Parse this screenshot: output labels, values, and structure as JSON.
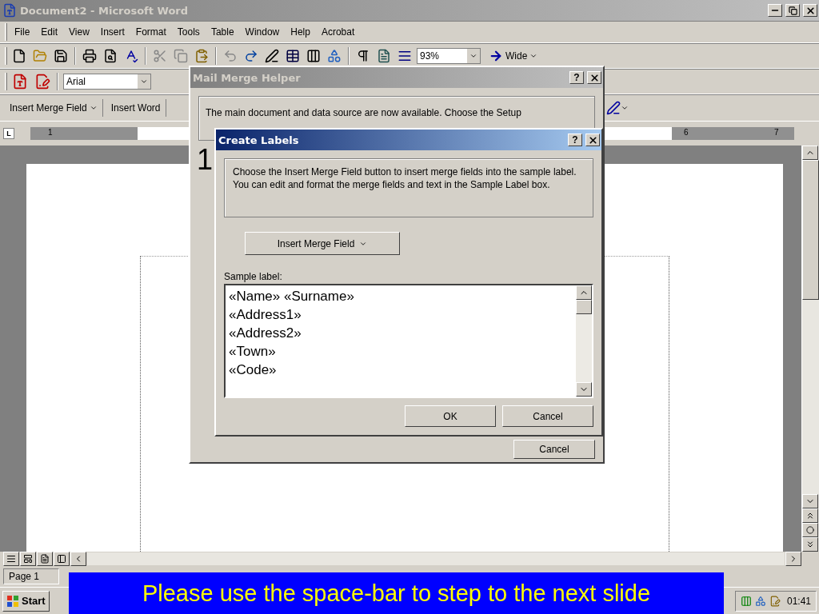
{
  "window": {
    "title": "Document2 - Microsoft Word",
    "active": false
  },
  "menu": [
    "File",
    "Edit",
    "View",
    "Insert",
    "Format",
    "Tools",
    "Table",
    "Window",
    "Help",
    "Acrobat"
  ],
  "standard_toolbar": {
    "zoom": "93%",
    "wide": "Wide"
  },
  "formatting_toolbar": {
    "font": "Arial"
  },
  "merge_toolbar": [
    {
      "label": "Insert Merge Field",
      "kind": "dropdown"
    },
    {
      "label": "Insert Word",
      "kind": "plain"
    }
  ],
  "ruler": {
    "tab_selector": "L",
    "numbers": [
      "1",
      "6",
      "7"
    ]
  },
  "mail_merge_helper": {
    "title": "Mail Merge Helper",
    "active": false,
    "help": "?",
    "intro": "The main document and data source are now available. Choose the Setup",
    "steps": [
      "1"
    ],
    "buttons": [
      "Cancel"
    ]
  },
  "create_labels": {
    "title": "Create Labels",
    "active": true,
    "help": "?",
    "instructions": "Choose the Insert Merge Field button to insert merge fields into the sample label.  You can edit and format the merge fields and text in the Sample Label box.",
    "insert_button": "Insert Merge Field",
    "sample_label": "Sample label:",
    "sample_lines": [
      "«Name» «Surname»",
      "«Address1»",
      "«Address2»",
      "«Town»",
      "«Code»"
    ],
    "buttons": [
      "OK",
      "Cancel"
    ]
  },
  "status_bar": {
    "page": "Page 1"
  },
  "taskbar": {
    "start": "Start",
    "clock": "01:41"
  },
  "banner": {
    "text": "Please use the space-bar to step to the next slide"
  }
}
